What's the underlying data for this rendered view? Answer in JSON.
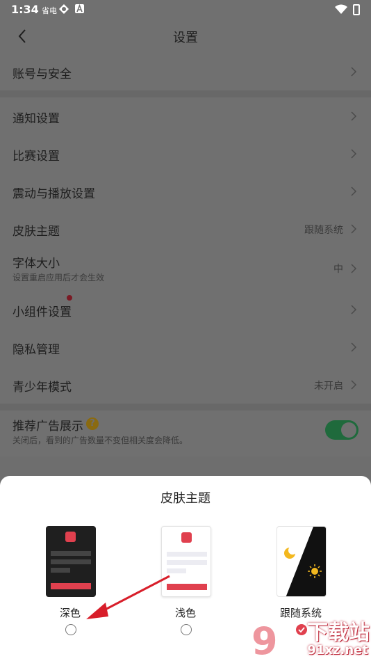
{
  "status_bar": {
    "time": "1:34",
    "icons": [
      "carrier-icon",
      "app-icon",
      "notification-a-icon",
      "wifi-icon",
      "battery-icon"
    ],
    "carrier_text": "省电"
  },
  "nav": {
    "title": "设置",
    "back_icon": "chevron-left-icon"
  },
  "settings": {
    "account": "账号与安全",
    "notify": "通知设置",
    "match": "比赛设置",
    "vibrate": "震动与播放设置",
    "skin": {
      "label": "皮肤主题",
      "value": "跟随系统"
    },
    "font": {
      "label": "字体大小",
      "sub": "设置重启应用后才会生效",
      "value": "中"
    },
    "widget": "小组件设置",
    "privacy": "隐私管理",
    "teen": {
      "label": "青少年模式",
      "value": "未开启"
    },
    "ads": {
      "label": "推荐广告展示",
      "help": "?",
      "sub": "关闭后，看到的广告数量不变但相关度会降低。",
      "enabled": true
    }
  },
  "sheet": {
    "title": "皮肤主题",
    "options": [
      {
        "label": "深色",
        "selected": false
      },
      {
        "label": "浅色",
        "selected": false
      },
      {
        "label": "跟随系统",
        "selected": true
      }
    ]
  },
  "colors": {
    "accent": "#e0404e",
    "toggle_on": "#2e9a58",
    "overlay": "#6e6e6e",
    "sheet_bg": "#ffffff"
  },
  "watermark": {
    "big": "下载站",
    "small": "91xz.net",
    "logo": "9"
  }
}
